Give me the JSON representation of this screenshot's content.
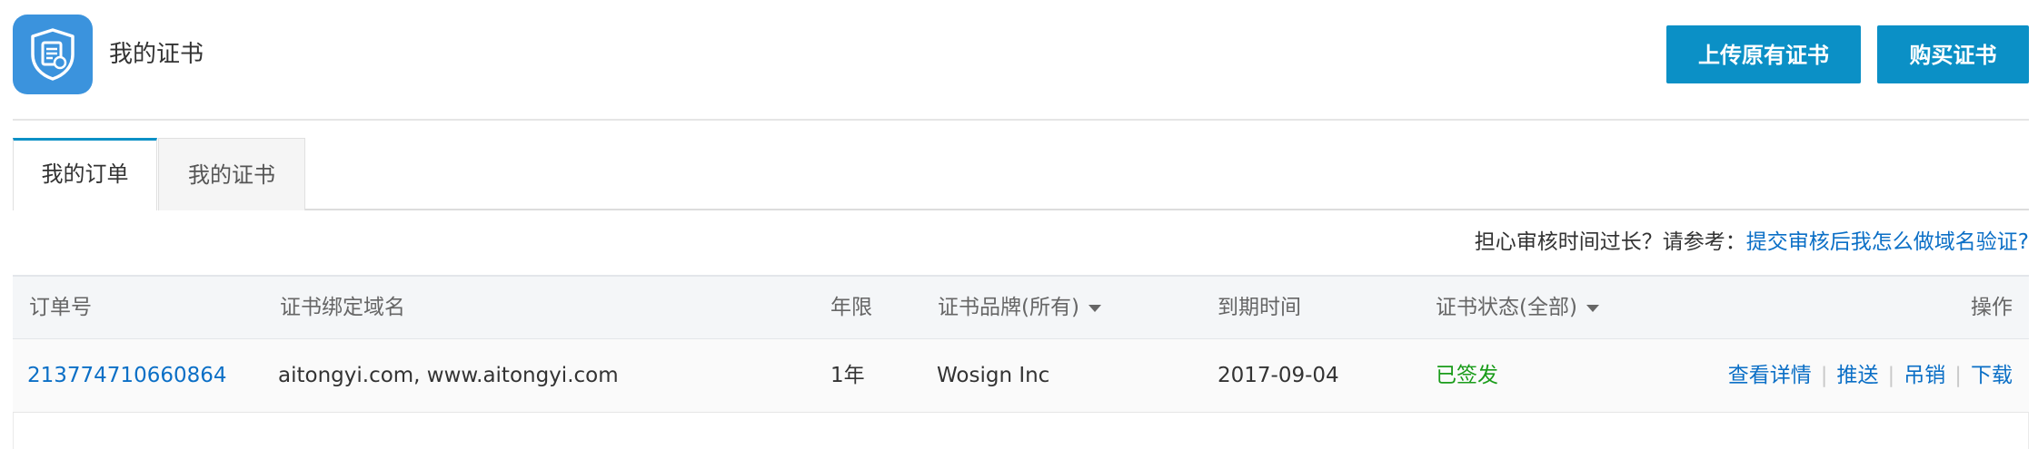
{
  "header": {
    "title": "我的证书",
    "icon": "certificate-shield-icon",
    "upload_label": "上传原有证书",
    "buy_label": "购买证书",
    "accent": "#0b90c6"
  },
  "tabs": [
    {
      "label": "我的订单",
      "active": true
    },
    {
      "label": "我的证书",
      "active": false
    }
  ],
  "help": {
    "question": "担心审核时间过长？请参考：",
    "link": "提交审核后我怎么做域名验证?"
  },
  "table": {
    "columns": {
      "order_no": "订单号",
      "domain": "证书绑定域名",
      "term": "年限",
      "brand": "证书品牌(所有)",
      "expiry": "到期时间",
      "status": "证书状态(全部)",
      "ops": "操作"
    },
    "rows": [
      {
        "order_no": "213774710660864",
        "domain": "aitongyi.com, www.aitongyi.com",
        "term": "1年",
        "brand": "Wosign Inc",
        "expiry": "2017-09-04",
        "status": "已签发",
        "ops": [
          "查看详情",
          "推送",
          "吊销",
          "下载"
        ]
      }
    ]
  },
  "colors": {
    "link": "#0b6fc6",
    "status_issued": "#1a9c1a"
  }
}
